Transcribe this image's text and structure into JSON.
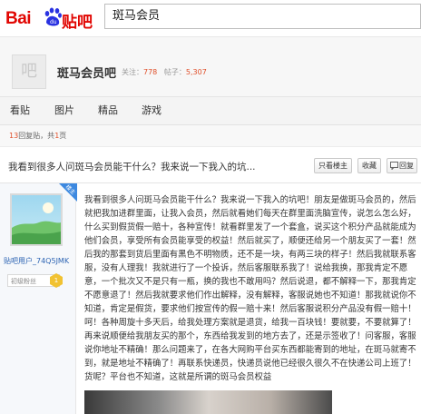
{
  "header": {
    "logo_text_left": "Bai",
    "logo_text_right": "贴吧",
    "logo_icon": "paw-icon",
    "search_value": "斑马会员"
  },
  "forum": {
    "avatar_glyph": "吧",
    "name": "斑马会员吧",
    "follow_label": "关注：",
    "follow_count": "778",
    "posts_label": "帖子：",
    "posts_count": "5,307"
  },
  "nav": {
    "items": [
      "看贴",
      "图片",
      "精品",
      "游戏"
    ]
  },
  "pager": {
    "reply_count": "13",
    "reply_text": "回复贴，共",
    "page_count": "1",
    "page_text": "页"
  },
  "thread": {
    "title": "我看到很多人问斑马会员能干什么？我来说一下我入的坑...",
    "btn_only_op": "只看楼主",
    "btn_collect": "收藏",
    "btn_reply": "回复",
    "reply_icon": "reply-icon"
  },
  "post": {
    "author_badge": "楼主",
    "author_name": "贴吧用户_74Q5JMK",
    "level_label": "初级粉丝",
    "level_num": "1",
    "content": "我看到很多人问斑马会员能干什么？我来说一下我入的坑吧！朋友是做斑马会员的，然后就把我加进群里面，让我入会员，然后就看她们每天在群里面洗脑宣传，说怎么怎么好，什么买到假货假一赔十，各种宣传！就看群里发了一个套盒，说买这个积分产品就能成为他们会员，享受所有会员能享受的权益！然后就买了，顺便还给另一个朋友买了一套！然后我的那套到货后里面有黑色不明物质，还不是一块，有两三块的样子！然后我就联系客服，没有人理我！我就进行了一个投诉，然后客服联系我了！说给我换，那我肯定不愿意，一个批次又不是只有一瓶，换的我也不敢用吗？然后说退，都不解释一下，那我肯定不愿意退了！然后我就要求他们作出解释，没有解释，客服说她也不知道！那我就说你不知道，肯定是假货，要求他们按宣传的假一赔十来！然后客服说积分产品没有假一赔十！呵！各种周旋十多天后，给我处理方案就是退货，给我一百块钱！要就要，不要就算了！再来说顺便给我朋友买的那个，东西给我发到的地方去了，还是示签收了！问客服，客服说你地址不精确！那么问题来了，在各大网购平台买东西都能寄到的地址，在斑马就寄不到，就是地址不精确了！再联系快递员，快递员说他已经很久很久不在快递公司上班了！货呢？平台也不知道，这就是所谓的斑马会员权益"
  }
}
